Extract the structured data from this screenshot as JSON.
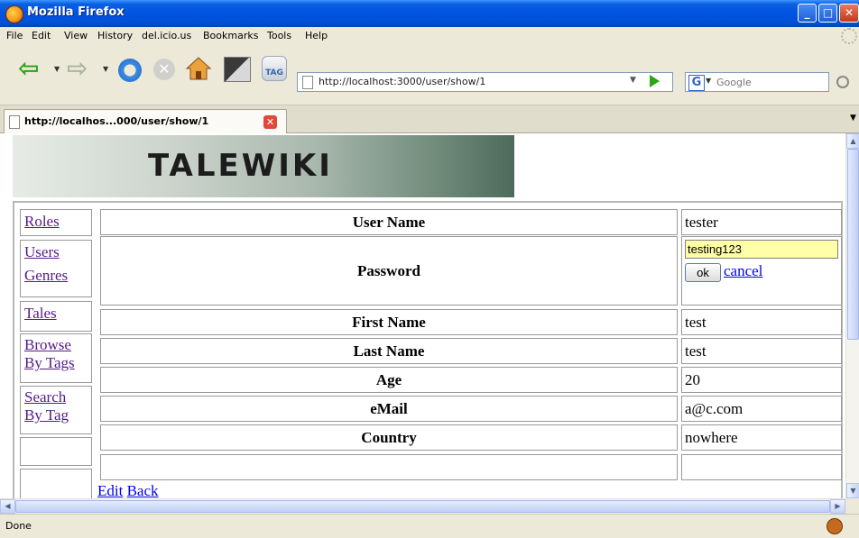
{
  "window": {
    "title": "Mozilla Firefox"
  },
  "menu": [
    "File",
    "Edit",
    "View",
    "History",
    "del.icio.us",
    "Bookmarks",
    "Tools",
    "Help"
  ],
  "toolbar": {
    "tag_label": "TAG",
    "url": "http://localhost:3000/user/show/1",
    "search_engine_glyph": "G",
    "search_placeholder": "Google"
  },
  "tabs": [
    {
      "title": "http://localhos...000/user/show/1",
      "active": true
    }
  ],
  "page": {
    "banner_title": "TALEWIKI",
    "sidebar": [
      "Roles",
      "Users",
      "Genres",
      "Tales",
      "Browse By Tags",
      "Search By Tag"
    ],
    "rows": [
      {
        "label": "User Name",
        "value": "tester"
      },
      {
        "label": "Password",
        "editing": true,
        "input_value": "testing123",
        "ok": "ok",
        "cancel": "cancel"
      },
      {
        "label": "First Name",
        "value": "test"
      },
      {
        "label": "Last Name",
        "value": "test"
      },
      {
        "label": "Age",
        "value": "20"
      },
      {
        "label": "eMail",
        "value": "a@c.com"
      },
      {
        "label": "Country",
        "value": "nowhere"
      }
    ],
    "footer_links": [
      "Edit",
      "Back"
    ]
  },
  "status": {
    "text": "Done"
  },
  "colors": {
    "titlebar": "#0053e1",
    "link_visited": "#551a8b",
    "link": "#0000ee",
    "edit_field_bg": "#ffffa8"
  }
}
